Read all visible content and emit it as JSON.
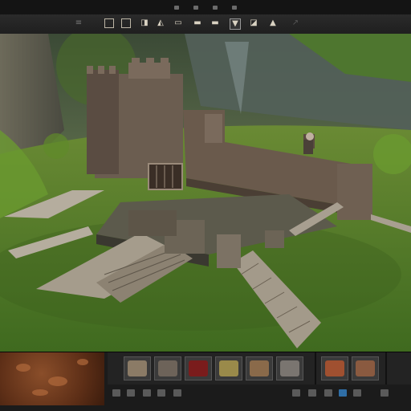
{
  "topbar": {
    "items": [
      "menu-a",
      "menu-b",
      "menu-c",
      "menu-d"
    ]
  },
  "toolbar": {
    "tools": [
      {
        "name": "select-tool",
        "glyph": "▫"
      },
      {
        "name": "move-tool",
        "glyph": "▫"
      },
      {
        "name": "rotate-tool",
        "glyph": "◨"
      },
      {
        "name": "scale-tool",
        "glyph": "◭"
      },
      {
        "name": "terrain-tool",
        "glyph": "▭"
      },
      {
        "name": "paint-tool",
        "glyph": "▬"
      },
      {
        "name": "shield-tool",
        "glyph": "▼"
      },
      {
        "name": "object-tool",
        "glyph": "◪"
      },
      {
        "name": "warning-tool",
        "glyph": "▲"
      }
    ]
  },
  "colors": {
    "grass": "#4f7a2a",
    "stone": "#6a5a4c",
    "sky": "#2b3f2a",
    "accent": "#2f6ea6"
  },
  "assets": {
    "thumbs": [
      {
        "name": "asset-rock",
        "color": "#8b7b66"
      },
      {
        "name": "asset-skull",
        "color": "#6d6359"
      },
      {
        "name": "asset-sign",
        "color": "#7a1c1c"
      },
      {
        "name": "asset-creature",
        "color": "#9a8a4a"
      },
      {
        "name": "asset-chest",
        "color": "#8a6a4a"
      },
      {
        "name": "asset-ruins",
        "color": "#7a7570"
      },
      {
        "name": "asset-fire",
        "color": "#a05030"
      },
      {
        "name": "asset-barrel",
        "color": "#8a5a40"
      }
    ]
  },
  "status": {
    "text": ""
  }
}
